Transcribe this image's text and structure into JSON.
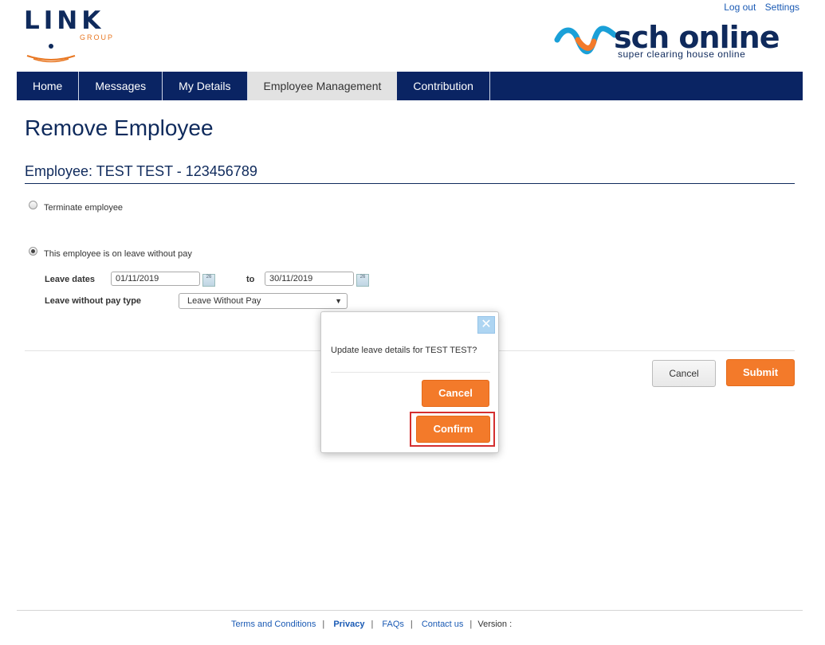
{
  "header": {
    "logo_text": "LINK",
    "logo_subtext": "GROUP",
    "links": {
      "logout": "Log out",
      "settings": "Settings"
    },
    "brand_name": "sch online",
    "brand_tagline": "super clearing house online"
  },
  "nav": {
    "tabs": [
      {
        "label": "Home"
      },
      {
        "label": "Messages"
      },
      {
        "label": "My Details"
      },
      {
        "label": "Employee Management"
      },
      {
        "label": "Contribution"
      }
    ],
    "active": "Employee Management"
  },
  "page": {
    "title": "Remove Employee",
    "employee_heading": "Employee: TEST TEST - 123456789"
  },
  "form": {
    "terminate_label": "Terminate employee",
    "leave_label": "This employee is on leave without pay",
    "selected_option": "leave",
    "leave_dates_label": "Leave dates",
    "from_date": "01/11/2019",
    "to_label": "to",
    "to_date": "30/11/2019",
    "calendar_icon_text": "26",
    "leave_type_label": "Leave without pay type",
    "leave_type_value": "Leave Without Pay"
  },
  "actions": {
    "cancel": "Cancel",
    "submit": "Submit"
  },
  "dialog": {
    "message": "Update leave details for TEST TEST?",
    "cancel": "Cancel",
    "confirm": "Confirm",
    "close_glyph": "✕"
  },
  "footer": {
    "terms": "Terms and Conditions",
    "privacy": "Privacy",
    "faqs": "FAQs",
    "contact": "Contact us",
    "version": "Version :"
  },
  "colors": {
    "navy": "#0a2463",
    "orange": "#f37a2a",
    "link_blue": "#1a5ab4",
    "highlight_red": "#d42f2f"
  }
}
